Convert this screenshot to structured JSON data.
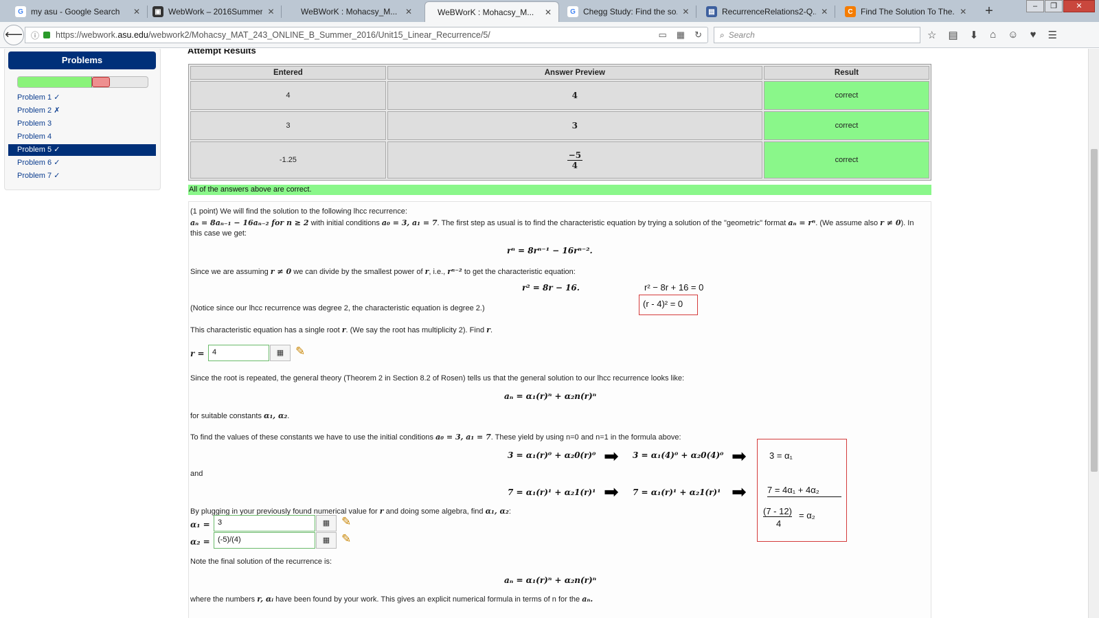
{
  "browser": {
    "tabs": [
      {
        "title": "my asu - Google Search",
        "icon": "google-icon",
        "color": "#4285f4",
        "glyph": "G"
      },
      {
        "title": "WebWork – 2016Summer...",
        "icon": "weblogo-icon",
        "color": "#444444",
        "glyph": "▣"
      },
      {
        "title": "WeBWorK : Mohacsy_M...",
        "icon": "none",
        "color": "",
        "glyph": ""
      },
      {
        "title": "WeBWorK : Mohacsy_M...",
        "icon": "none",
        "color": "",
        "glyph": ""
      },
      {
        "title": "Chegg Study: Find the so...",
        "icon": "google-icon",
        "color": "#4285f4",
        "glyph": "G"
      },
      {
        "title": "RecurrenceRelations2-Q...",
        "icon": "doc-icon",
        "color": "#3d5f9e",
        "glyph": "▤"
      },
      {
        "title": "Find The Solution To The...",
        "icon": "chegg-icon",
        "color": "#f57c00",
        "glyph": "C"
      }
    ],
    "active_tab_index": 3,
    "url_prefix": "https://webwork.",
    "url_domain": "asu.edu",
    "url_path": "/webwork2/Mohacsy_MAT_243_ONLINE_B_Summer_2016/Unit15_Linear_Recurrence/5/",
    "search_placeholder": "Search",
    "new_tab": "+"
  },
  "sidebar": {
    "header": "Problems",
    "progress": {
      "correct_fraction": 0.57,
      "incorrect_fraction": 0.14
    },
    "problems": [
      {
        "label": "Problem 1 ✓",
        "current": false
      },
      {
        "label": "Problem 2 ✗",
        "current": false
      },
      {
        "label": "Problem 3",
        "current": false
      },
      {
        "label": "Problem 4",
        "current": false
      },
      {
        "label": "Problem 5 ✓",
        "current": true
      },
      {
        "label": "Problem 6 ✓",
        "current": false
      },
      {
        "label": "Problem 7 ✓",
        "current": false
      }
    ]
  },
  "results": {
    "title": "Attempt Results",
    "headers": [
      "Entered",
      "Answer Preview",
      "Result"
    ],
    "rows": [
      {
        "entered": "4",
        "preview": "4",
        "result": "correct"
      },
      {
        "entered": "3",
        "preview": "3",
        "result": "correct"
      },
      {
        "entered": "-1.25",
        "preview_num": "−5",
        "preview_den": "4",
        "result": "correct"
      }
    ],
    "summary": "All of the answers above are correct."
  },
  "problem": {
    "intro": "(1 point) We will find the solution to the following lhcc recurrence:",
    "recurrence": "aₙ = 8aₙ₋₁ − 16aₙ₋₂ for n ≥ 2",
    "initial_text_1": "with initial conditions",
    "initial_conditions": "a₀ = 3, a₁ = 7",
    "initial_text_2": ". The first step as usual is to find the characteristic equation by trying a solution of the \"geometric\" format",
    "geometric": "aₙ = rⁿ",
    "assume_text": ". (We assume also",
    "r_nonzero": "r ≠ 0",
    "assume_end": "). In",
    "this_case": "this case we get:",
    "eq_rn": "rⁿ = 8rⁿ⁻¹ − 16rⁿ⁻².",
    "since_assuming": "Since we are assuming",
    "divide_text": "we can divide by the smallest power of",
    "ie_text": ", i.e.,",
    "r_power": "rⁿ⁻²",
    "to_get": "to get the characteristic equation:",
    "r_sym": "r",
    "char_eq": "r² = 8r − 16.",
    "notice": "(Notice since our lhcc recurrence was degree 2, the characteristic equation is degree 2.)",
    "single_root": "This characteristic equation has a single root",
    "multiplicity": ". (We say the root has multiplicity 2). Find",
    "period": ".",
    "r_label": "r =",
    "r_value": "4",
    "since_repeated": "Since the root is repeated, the general theory (Theorem 2 in Section 8.2 of Rosen) tells us that the general solution to our lhcc recurrence looks like:",
    "general_solution": "aₙ = α₁(r)ⁿ + α₂n(r)ⁿ",
    "suitable": "for suitable constants",
    "constants": "α₁, α₂",
    "find_values": "To find the values of these constants we have to use the initial conditions",
    "yield_text": ". These yield by using n=0 and n=1 in the formula above:",
    "eq_n0": "3 = α₁(r)⁰ + α₂0(r)⁰",
    "and": "and",
    "eq_n1": "7 = α₁(r)¹ + α₂1(r)¹",
    "plugging": "By plugging in your previously found numerical value for",
    "algebra": "and doing some algebra, find",
    "colon": ":",
    "alpha1_label": "α₁ =",
    "alpha1_value": "3",
    "alpha2_label": "α₂ =",
    "alpha2_value": "(-5)/(4)",
    "note_final": "Note the final solution of the recurrence is:",
    "final_solution": "aₙ = α₁(r)ⁿ + α₂n(r)ⁿ",
    "where_numbers": "where the numbers",
    "found_text": "have been found by your work. This gives an explicit numerical formula in terms of n for the",
    "r_alpha_i": "r, αᵢ",
    "an": "aₙ."
  },
  "annotations": {
    "char_expanded": "r² − 8r + 16 = 0",
    "char_factored": "(r - 4)² = 0",
    "sub_n0": "3 = α₁(4)⁰ + α₂0(4)⁰",
    "sub_n1": "7 = α₁(r)¹ + α₂1(r)¹",
    "result_a1": "3 = α₁",
    "result_eq": "7 = 4α₁ + 4α₂",
    "result_frac_num": "(7 - 12)",
    "result_frac_den": "4",
    "result_frac_rhs": "= α₂"
  }
}
